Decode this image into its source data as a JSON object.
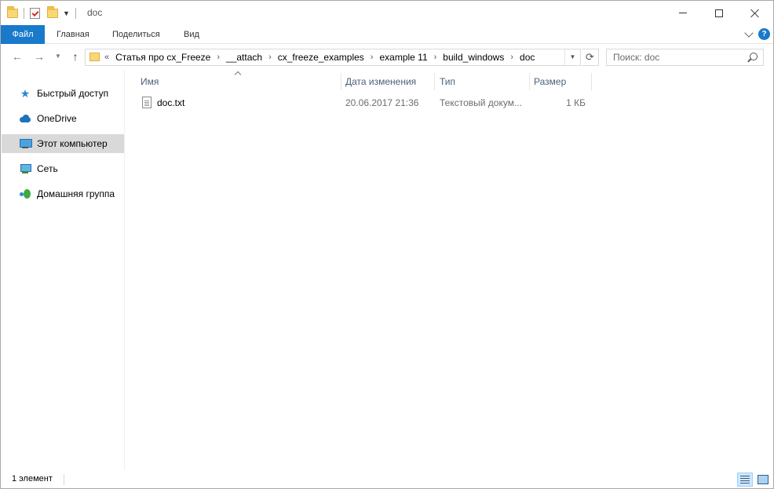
{
  "window": {
    "title": "doc"
  },
  "ribbon": {
    "tabs": [
      {
        "label": "Файл"
      },
      {
        "label": "Главная"
      },
      {
        "label": "Поделиться"
      },
      {
        "label": "Вид"
      }
    ],
    "help_label": "?"
  },
  "address": {
    "overflow": "«",
    "crumbs": [
      "Статья про cx_Freeze",
      "__attach",
      "cx_freeze_examples",
      "example 11",
      "build_windows",
      "doc"
    ]
  },
  "search": {
    "placeholder": "Поиск: doc"
  },
  "sidebar": {
    "items": [
      {
        "label": "Быстрый доступ",
        "icon": "star-icon"
      },
      {
        "label": "OneDrive",
        "icon": "cloud-icon"
      },
      {
        "label": "Этот компьютер",
        "icon": "computer-icon",
        "selected": true
      },
      {
        "label": "Сеть",
        "icon": "network-icon"
      },
      {
        "label": "Домашняя группа",
        "icon": "homegroup-icon"
      }
    ]
  },
  "columns": {
    "name": "Имя",
    "date": "Дата изменения",
    "type": "Тип",
    "size": "Размер"
  },
  "files": [
    {
      "name": "doc.txt",
      "date": "20.06.2017 21:36",
      "type": "Текстовый докум...",
      "size": "1 КБ",
      "icon": "text-file-icon"
    }
  ],
  "status": {
    "count": "1 элемент"
  },
  "colors": {
    "accent": "#1979ca",
    "selected_nav": "#d9d9d9",
    "header_text": "#4c607a"
  }
}
